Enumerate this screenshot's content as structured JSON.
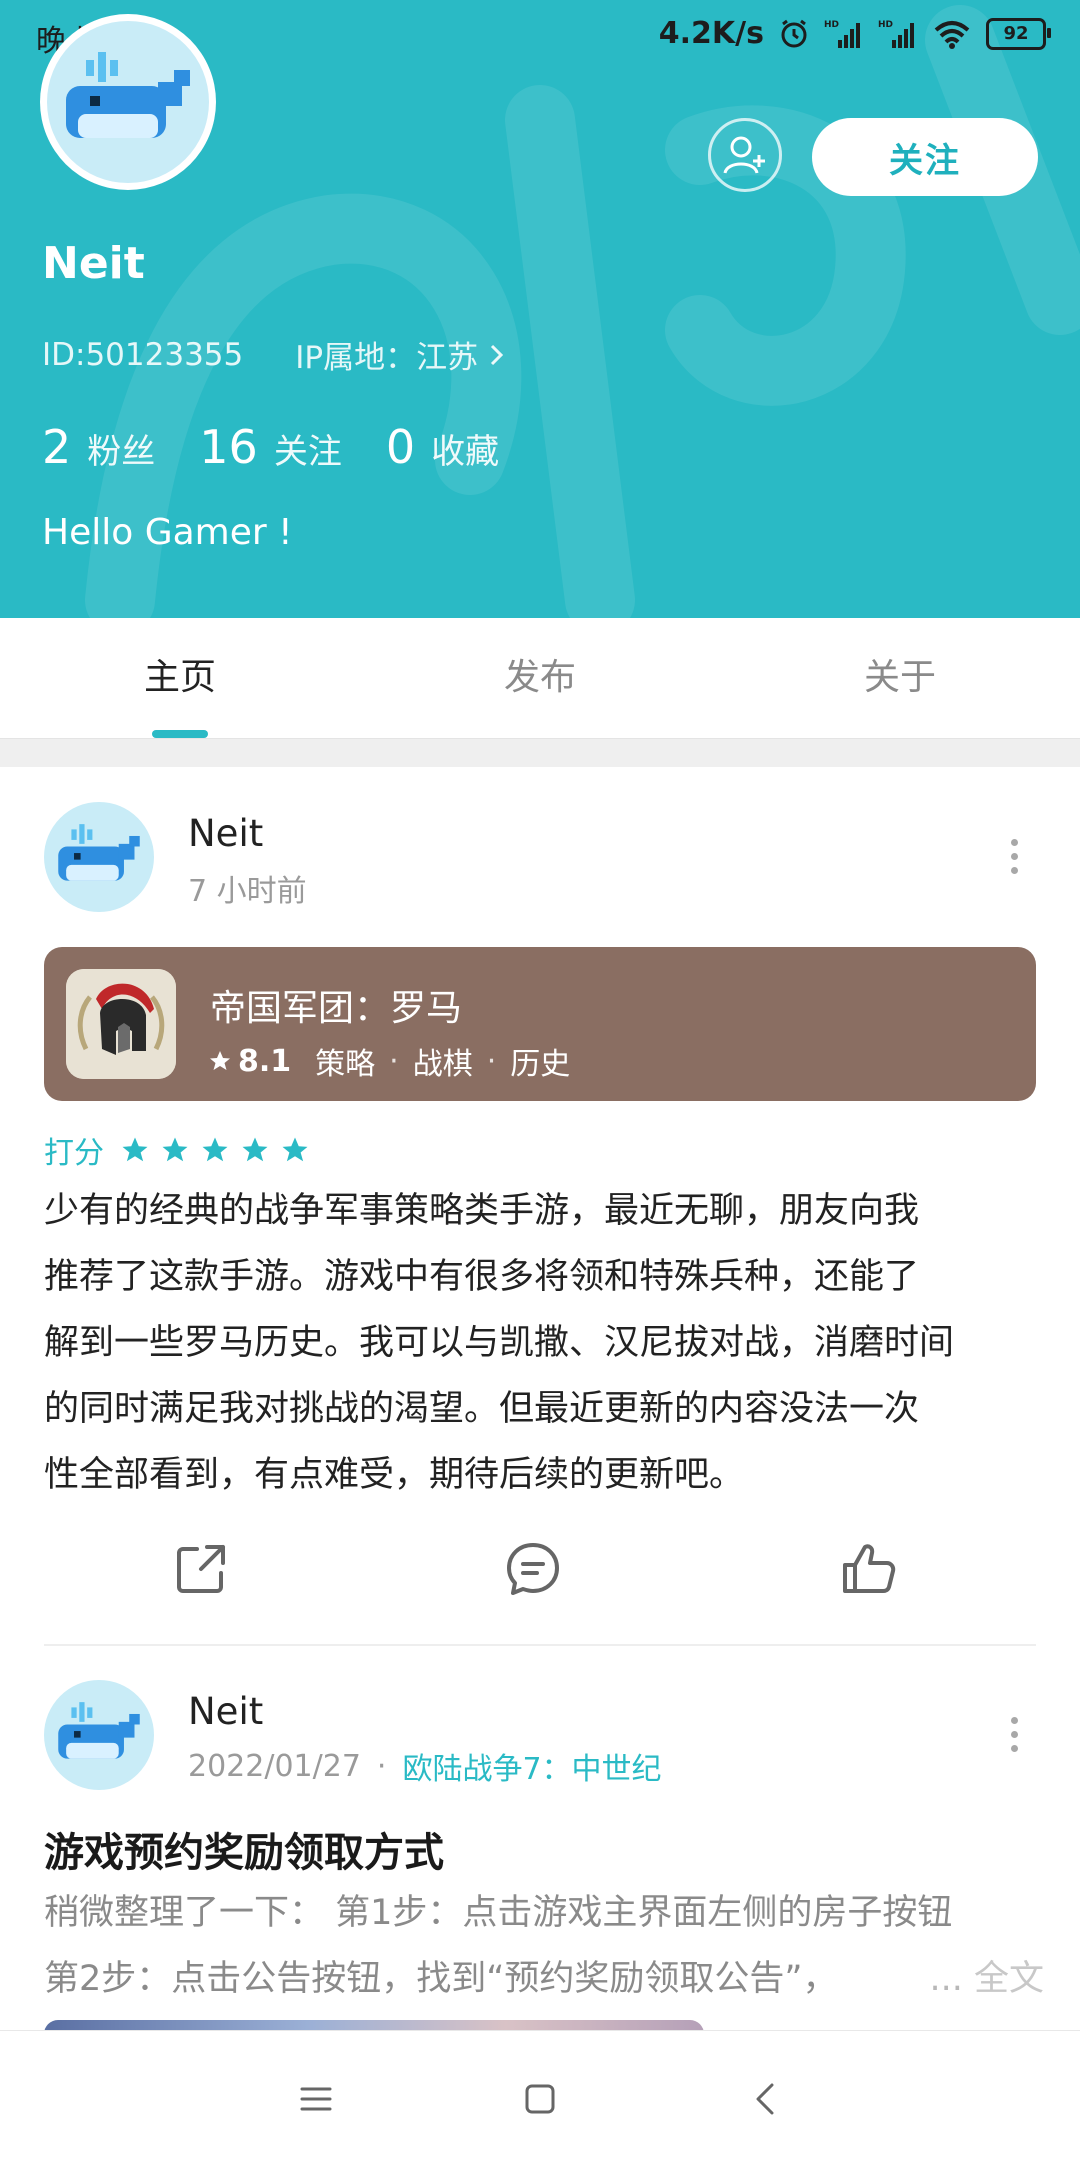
{
  "status_bar": {
    "time": "晚上7:06",
    "network_speed": "4.2K/s",
    "battery": "92",
    "icons": [
      "alarm-icon",
      "signal-hd-icon",
      "signal-hd-icon",
      "wifi-icon",
      "battery-icon"
    ]
  },
  "profile": {
    "name": "Neit",
    "id_text": "ID:50123355",
    "ip_text": "IP属地：江苏",
    "stats": [
      {
        "value": "2",
        "label": "粉丝"
      },
      {
        "value": "16",
        "label": "关注"
      },
      {
        "value": "0",
        "label": "收藏"
      }
    ],
    "bio": "Hello Gamer !",
    "follow_label": "关注",
    "accent_color": "#2abac5"
  },
  "tabs": [
    {
      "label": "主页",
      "active": true
    },
    {
      "label": "发布",
      "active": false
    },
    {
      "label": "关于",
      "active": false
    }
  ],
  "posts": [
    {
      "author": "Neit",
      "time": "7 小时前",
      "game": {
        "title": "帝国军团：罗马",
        "rating": "8.1",
        "tags": [
          "策略",
          "战棋",
          "历史"
        ]
      },
      "score_label": "打分",
      "score_stars": 5,
      "review_lines": [
        "少有的经典的战争军事策略类手游，最近无聊，朋友向我",
        "推荐了这款手游。游戏中有很多将领和特殊兵种，还能了",
        "解到一些罗马历史。我可以与凯撒、汉尼拔对战，消磨时间",
        "的同时满足我对挑战的渴望。但最近更新的内容没法一次",
        "性全部看到，有点难受，期待后续的更新吧。"
      ]
    },
    {
      "author": "Neit",
      "date": "2022/01/27",
      "dot": "·",
      "game_link": "欧陆战争7：中世纪",
      "title": "游戏预约奖励领取方式",
      "excerpt_lines": [
        "稍微整理了一下： 第1步：点击游戏主界面左侧的房子按钮",
        "第2步：点击公告按钮，找到“预约奖励领取公告”，"
      ],
      "ellipsis": "...",
      "read_more": "全文"
    }
  ]
}
